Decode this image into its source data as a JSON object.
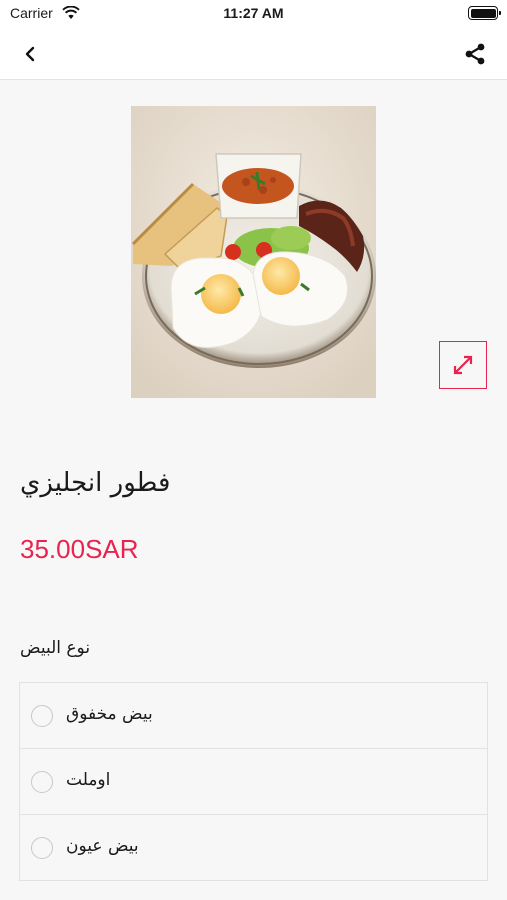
{
  "status_bar": {
    "carrier": "Carrier",
    "time": "11:27 AM"
  },
  "icons": {
    "back": "chevron-left-icon",
    "share": "share-icon",
    "expand": "expand-arrows-icon"
  },
  "product": {
    "title": "فطور انجليزي",
    "price": "35.00SAR"
  },
  "options_group": {
    "title": "نوع البيض",
    "items": [
      {
        "label": "بيض مخفوق"
      },
      {
        "label": "اوملت"
      },
      {
        "label": "بيض عيون"
      }
    ]
  },
  "colors": {
    "accent": "#e8234f",
    "background": "#f7f7f7"
  }
}
